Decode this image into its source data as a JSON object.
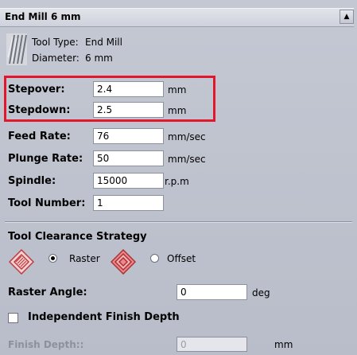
{
  "header": {
    "title": "End Mill 6 mm",
    "collapse_glyph": "▲"
  },
  "tool_info": {
    "type_label": "Tool Type:",
    "type_value": "End Mill",
    "diameter_label": "Diameter:",
    "diameter_value": "6 mm",
    "icon": "end-mill-icon"
  },
  "params": {
    "stepover": {
      "label": "Stepover:",
      "value": "2.4",
      "unit": "mm"
    },
    "stepdown": {
      "label": "Stepdown:",
      "value": "2.5",
      "unit": "mm"
    },
    "feed_rate": {
      "label": "Feed Rate:",
      "value": "76",
      "unit": "mm/sec"
    },
    "plunge_rate": {
      "label": "Plunge Rate:",
      "value": "50",
      "unit": "mm/sec"
    },
    "spindle": {
      "label": "Spindle:",
      "value": "15000",
      "unit": "r.p.m"
    },
    "tool_number": {
      "label": "Tool Number:",
      "value": "1"
    }
  },
  "clearance": {
    "heading": "Tool Clearance Strategy",
    "raster_label": "Raster",
    "offset_label": "Offset",
    "selected": "Raster",
    "raster_angle": {
      "label": "Raster Angle:",
      "value": "0",
      "unit": "deg"
    }
  },
  "finish": {
    "checkbox_label": "Independent Finish Depth",
    "checked": false,
    "depth": {
      "label": "Finish Depth::",
      "value": "0",
      "unit": "mm"
    }
  },
  "colors": {
    "highlight": "#e2172c",
    "panel": "#c0c4cf"
  }
}
